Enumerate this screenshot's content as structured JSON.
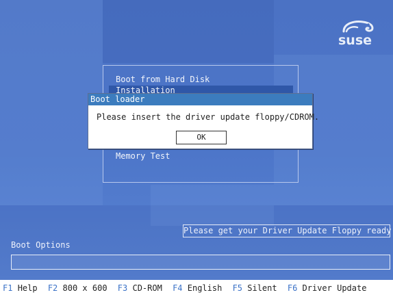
{
  "logo": {
    "text": "suse",
    "icon": "chameleon-icon"
  },
  "boot_menu": {
    "items": [
      {
        "label": "Boot from Hard Disk",
        "selected": false
      },
      {
        "label": "Installation",
        "selected": true
      },
      {
        "label": "Memory Test",
        "selected": false
      }
    ]
  },
  "dialog": {
    "title": "Boot loader",
    "message": "Please insert the driver update floppy/CDROM.",
    "ok_label": "OK"
  },
  "hint": "Please get your Driver Update Floppy ready.",
  "boot_options": {
    "label": "Boot Options",
    "value": ""
  },
  "function_keys": [
    {
      "key": "F1",
      "label": "Help"
    },
    {
      "key": "F2",
      "label": "800 x 600"
    },
    {
      "key": "F3",
      "label": "CD-ROM"
    },
    {
      "key": "F4",
      "label": "English"
    },
    {
      "key": "F5",
      "label": "Silent"
    },
    {
      "key": "F6",
      "label": "Driver Update"
    }
  ],
  "colors": {
    "background": "#4b72c4",
    "dialog_title": "#3c7cbe",
    "function_key": "#3b72c7",
    "selection": "#2f57a8"
  }
}
